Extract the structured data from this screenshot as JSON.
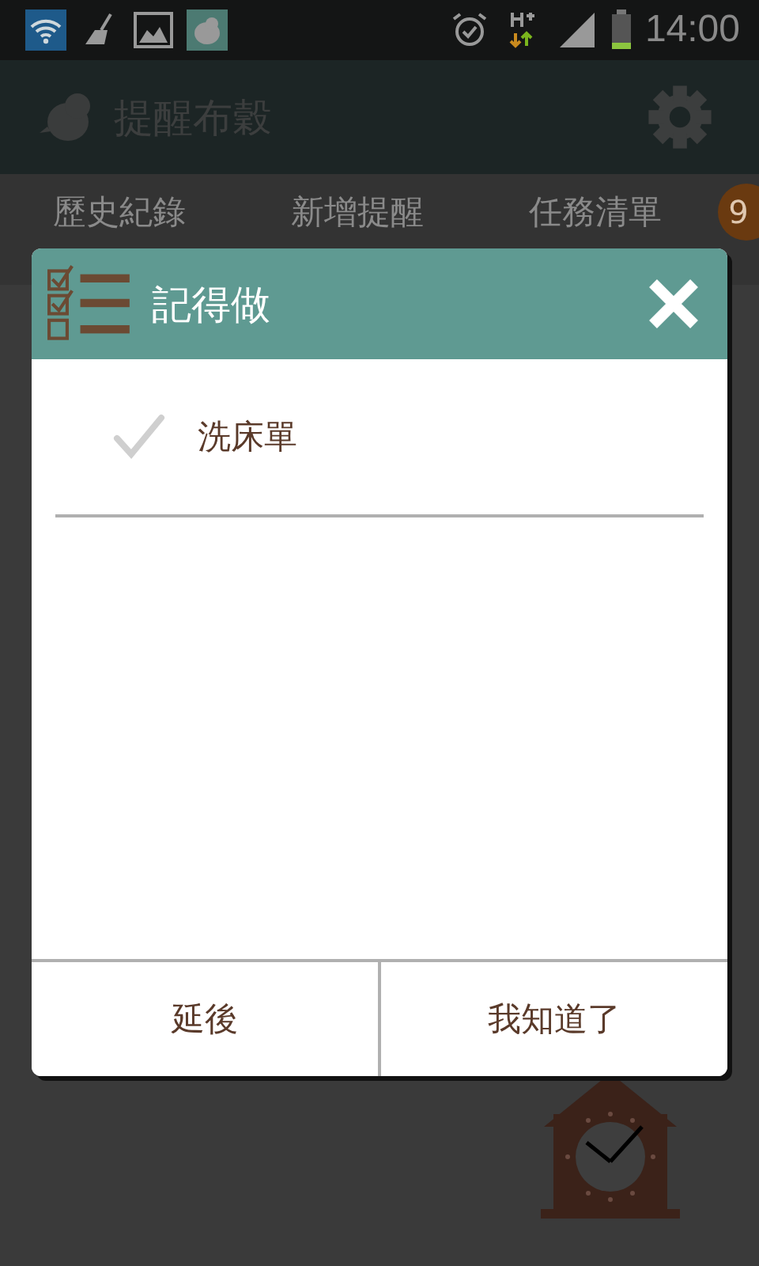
{
  "status_bar": {
    "time": "14:00"
  },
  "app_bar": {
    "title": "提醒布穀"
  },
  "tabs": [
    {
      "label": "歷史紀錄"
    },
    {
      "label": "新增提醒"
    },
    {
      "label": "任務清單",
      "badge": "9"
    }
  ],
  "dialog": {
    "title": "記得做",
    "items": [
      {
        "label": "洗床單",
        "checked": false
      }
    ],
    "buttons": [
      "延後",
      "我知道了"
    ]
  }
}
